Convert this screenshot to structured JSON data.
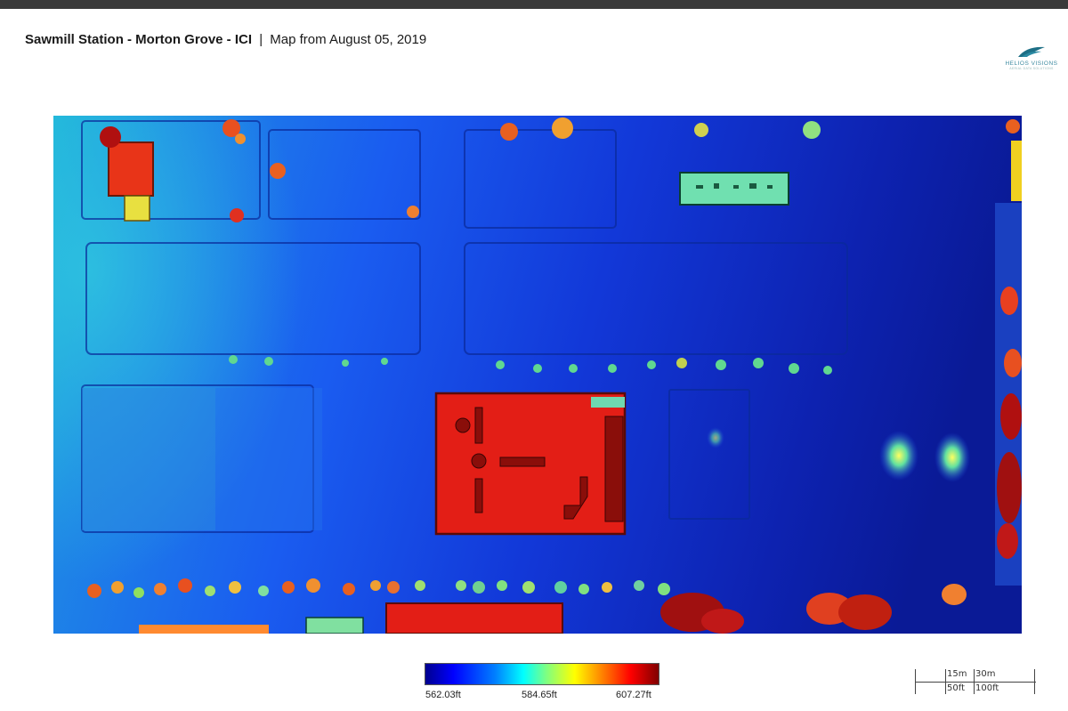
{
  "header": {
    "title_bold": "Sawmill Station - Morton Grove - ICI",
    "separator": "|",
    "subtitle": "Map from August 05, 2019"
  },
  "logo": {
    "name": "HELIOS VISIONS",
    "tagline": "AERIAL DATA SOLUTIONS"
  },
  "elevation_legend": {
    "min": "562.03ft",
    "mid": "584.65ft",
    "max": "607.27ft",
    "colors": [
      "#00008f",
      "#0000ff",
      "#0080ff",
      "#00ffff",
      "#80ff80",
      "#ffff00",
      "#ff8000",
      "#ff0000",
      "#800000"
    ]
  },
  "scale_bar": {
    "metric": [
      "15m",
      "30m"
    ],
    "imperial": [
      "50ft",
      "100ft"
    ]
  },
  "map": {
    "type": "elevation heatmap",
    "colors": {
      "low": "#0a1aa0",
      "mid_low": "#1560e8",
      "mid": "#2fb8e8",
      "high": "#e82010",
      "edge_green": "#5fd88a"
    }
  }
}
